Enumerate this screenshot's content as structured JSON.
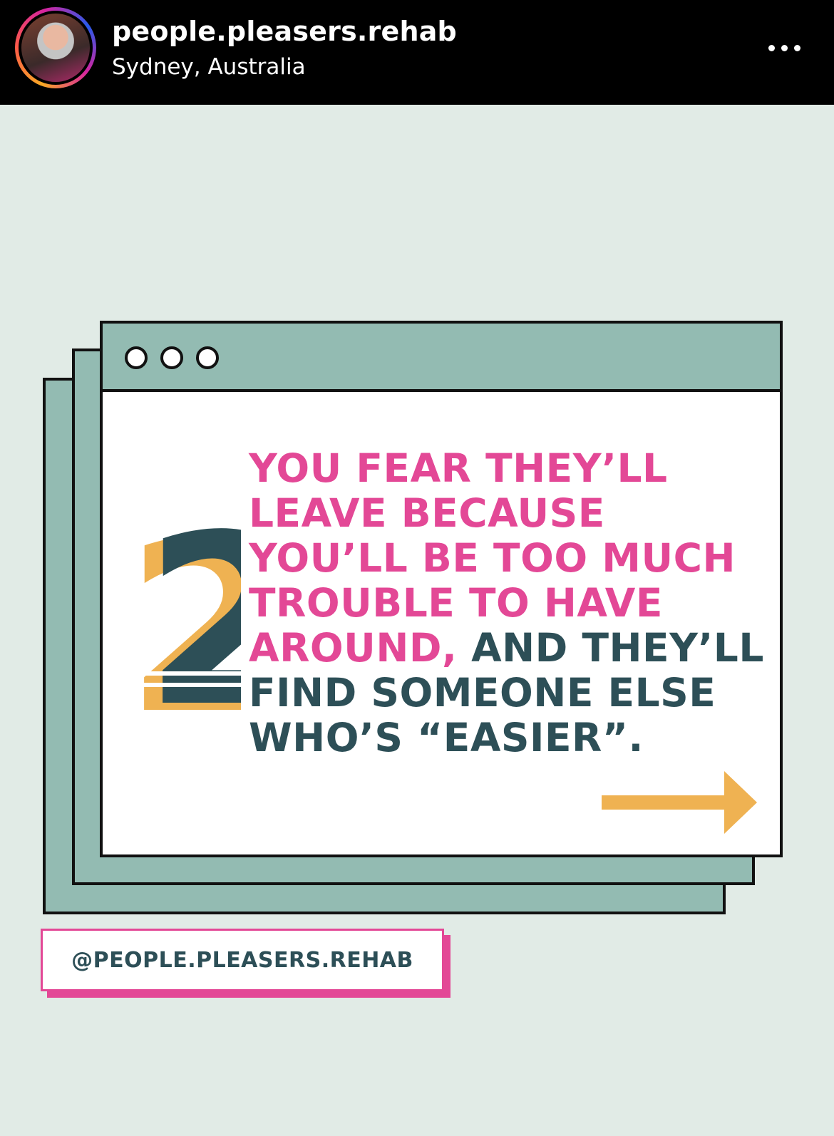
{
  "header": {
    "username": "people.pleasers.rehab",
    "location": "Sydney, Australia",
    "more_icon": "more-horizontal-icon"
  },
  "post": {
    "number": "2",
    "quote_pink": [
      "YOU FEAR THEY’LL",
      "LEAVE BECAUSE",
      "YOU’LL BE TOO MUCH",
      "TROUBLE TO HAVE",
      "AROUND,"
    ],
    "quote_teal_inline": " AND THEY’LL",
    "quote_teal": [
      "FIND SOMEONE ELSE",
      "WHO’S “EASIER”."
    ],
    "handle": "@PEOPLE.PLEASERS.REHAB",
    "arrow_icon": "arrow-right-icon"
  },
  "colors": {
    "pink": "#e34896",
    "teal_dark": "#2d4f57",
    "sage": "#93bbb2",
    "mustard": "#efb252",
    "background": "#e1ebe6"
  }
}
